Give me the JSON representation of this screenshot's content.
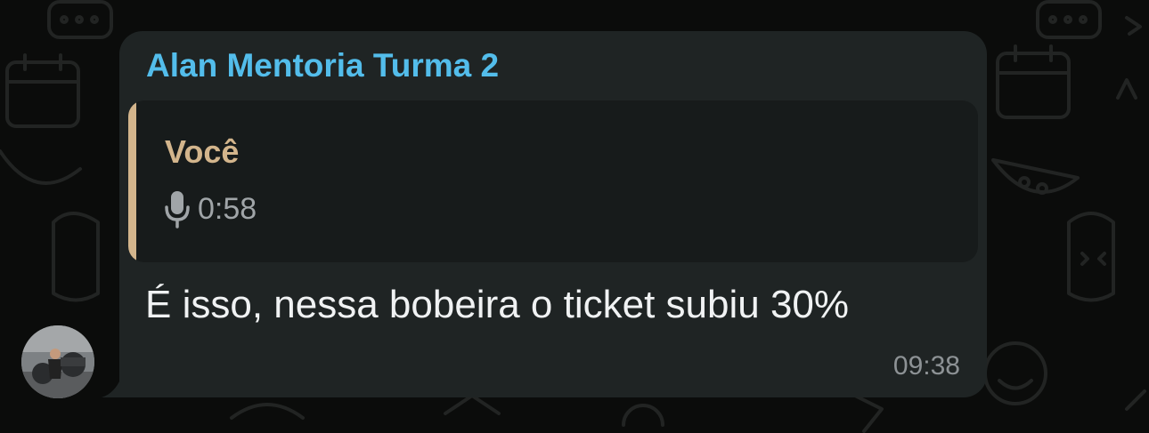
{
  "chat": {
    "group_name": "Alan Mentoria Turma 2",
    "message": {
      "quoted": {
        "author": "Você",
        "type": "voice-note",
        "icon": "microphone-icon",
        "duration": "0:58"
      },
      "text": "É isso, nessa bobeira o ticket subiu 30%",
      "time": "09:38"
    }
  },
  "colors": {
    "background": "#0b0c0b",
    "bubble": "#1f2424",
    "quote_background": "#171b1b",
    "sender_name": "#53bdeb",
    "quote_accent": "#d3b58c",
    "message_text": "#f0f2f3",
    "timestamp": "#8d9295"
  }
}
